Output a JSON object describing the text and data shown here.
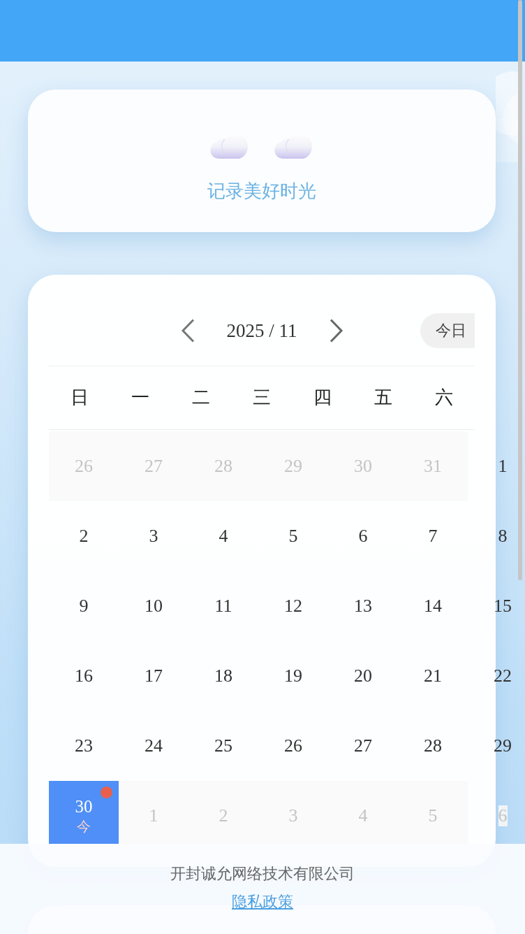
{
  "banner": {
    "title": "记录美好时光"
  },
  "calendar": {
    "month_label": "2025 / 11",
    "today_button": "今日",
    "weekdays": [
      "日",
      "一",
      "二",
      "三",
      "四",
      "五",
      "六"
    ],
    "days": [
      {
        "label": "26",
        "in_month": false,
        "selected": false,
        "marked": false
      },
      {
        "label": "27",
        "in_month": false,
        "selected": false,
        "marked": false
      },
      {
        "label": "28",
        "in_month": false,
        "selected": false,
        "marked": false
      },
      {
        "label": "29",
        "in_month": false,
        "selected": false,
        "marked": false
      },
      {
        "label": "30",
        "in_month": false,
        "selected": false,
        "marked": false
      },
      {
        "label": "31",
        "in_month": false,
        "selected": false,
        "marked": false
      },
      {
        "label": "1",
        "in_month": true,
        "selected": false,
        "marked": false
      },
      {
        "label": "2",
        "in_month": true,
        "selected": false,
        "marked": false
      },
      {
        "label": "3",
        "in_month": true,
        "selected": false,
        "marked": false
      },
      {
        "label": "4",
        "in_month": true,
        "selected": false,
        "marked": false
      },
      {
        "label": "5",
        "in_month": true,
        "selected": false,
        "marked": false
      },
      {
        "label": "6",
        "in_month": true,
        "selected": false,
        "marked": false
      },
      {
        "label": "7",
        "in_month": true,
        "selected": false,
        "marked": false
      },
      {
        "label": "8",
        "in_month": true,
        "selected": false,
        "marked": false
      },
      {
        "label": "9",
        "in_month": true,
        "selected": false,
        "marked": false
      },
      {
        "label": "10",
        "in_month": true,
        "selected": false,
        "marked": false
      },
      {
        "label": "11",
        "in_month": true,
        "selected": false,
        "marked": false
      },
      {
        "label": "12",
        "in_month": true,
        "selected": false,
        "marked": false
      },
      {
        "label": "13",
        "in_month": true,
        "selected": false,
        "marked": false
      },
      {
        "label": "14",
        "in_month": true,
        "selected": false,
        "marked": false
      },
      {
        "label": "15",
        "in_month": true,
        "selected": false,
        "marked": false
      },
      {
        "label": "16",
        "in_month": true,
        "selected": false,
        "marked": false
      },
      {
        "label": "17",
        "in_month": true,
        "selected": false,
        "marked": false
      },
      {
        "label": "18",
        "in_month": true,
        "selected": false,
        "marked": false
      },
      {
        "label": "19",
        "in_month": true,
        "selected": false,
        "marked": false
      },
      {
        "label": "20",
        "in_month": true,
        "selected": false,
        "marked": false
      },
      {
        "label": "21",
        "in_month": true,
        "selected": false,
        "marked": false
      },
      {
        "label": "22",
        "in_month": true,
        "selected": false,
        "marked": false
      },
      {
        "label": "23",
        "in_month": true,
        "selected": false,
        "marked": false
      },
      {
        "label": "24",
        "in_month": true,
        "selected": false,
        "marked": false
      },
      {
        "label": "25",
        "in_month": true,
        "selected": false,
        "marked": false
      },
      {
        "label": "26",
        "in_month": true,
        "selected": false,
        "marked": false
      },
      {
        "label": "27",
        "in_month": true,
        "selected": false,
        "marked": false
      },
      {
        "label": "28",
        "in_month": true,
        "selected": false,
        "marked": false
      },
      {
        "label": "29",
        "in_month": true,
        "selected": false,
        "marked": false
      },
      {
        "label": "30",
        "in_month": true,
        "selected": true,
        "marked": true,
        "note": "今"
      },
      {
        "label": "1",
        "in_month": false,
        "selected": false,
        "marked": false
      },
      {
        "label": "2",
        "in_month": false,
        "selected": false,
        "marked": false
      },
      {
        "label": "3",
        "in_month": false,
        "selected": false,
        "marked": false
      },
      {
        "label": "4",
        "in_month": false,
        "selected": false,
        "marked": false
      },
      {
        "label": "5",
        "in_month": false,
        "selected": false,
        "marked": false
      },
      {
        "label": "6",
        "in_month": false,
        "selected": false,
        "marked": false
      }
    ]
  },
  "footer": {
    "company": "开封诚允网络技术有限公司",
    "link": "隐私政策"
  }
}
